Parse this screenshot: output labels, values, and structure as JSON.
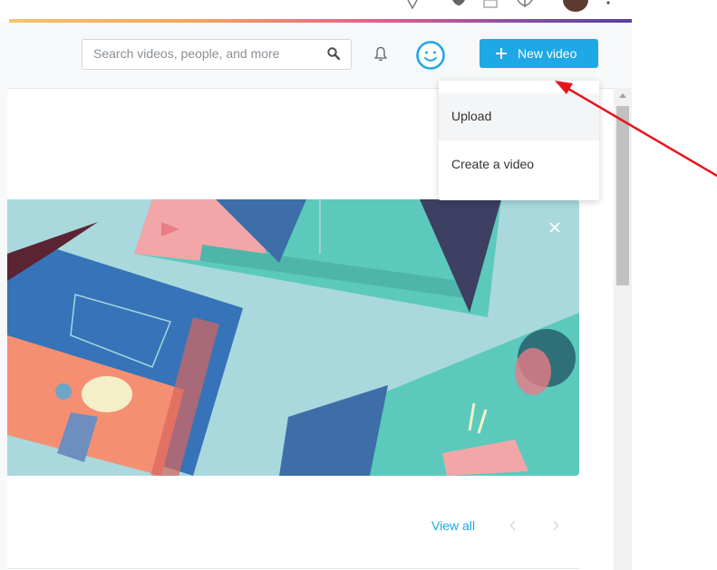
{
  "search": {
    "placeholder": "Search videos, people, and more",
    "icon": "search-icon"
  },
  "header": {
    "new_video_label": "New video",
    "new_video_icon": "plus-icon",
    "notifications_icon": "bell-icon",
    "avatar_icon": "smiley-avatar-icon"
  },
  "dropdown": {
    "items": [
      {
        "label": "Upload"
      },
      {
        "label": "Create a video"
      }
    ]
  },
  "banner": {
    "close_icon": "close-icon"
  },
  "pager": {
    "view_all_label": "View all",
    "prev_icon": "chevron-left-icon",
    "next_icon": "chevron-right-icon"
  },
  "colors": {
    "accent": "#1ea8e6",
    "header_bg": "#f6f8f9",
    "annotation_arrow": "#e8141c"
  }
}
